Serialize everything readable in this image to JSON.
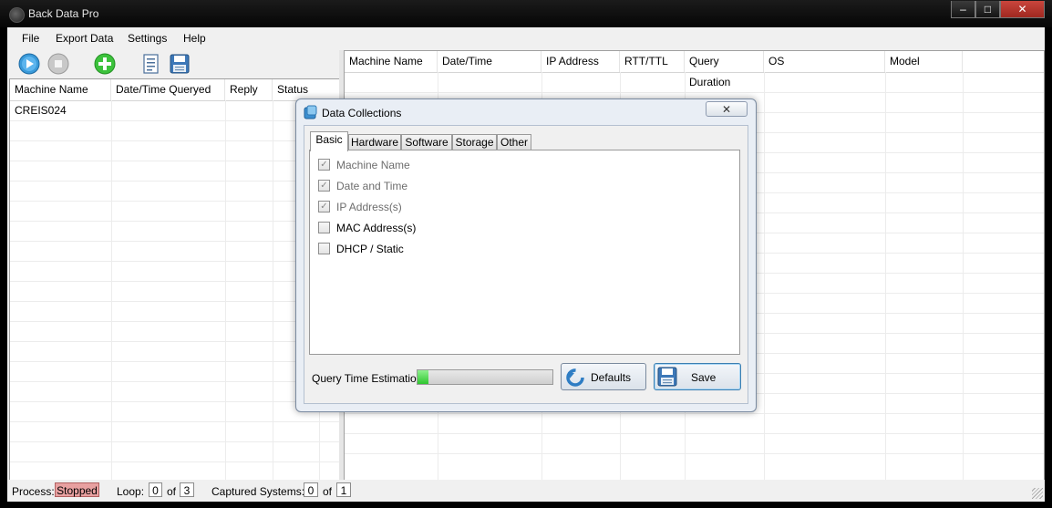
{
  "window": {
    "title": "Back Data Pro",
    "controls": [
      "‒",
      "□",
      "✕"
    ]
  },
  "menu": [
    "File",
    "Export Data",
    "Settings",
    "Help"
  ],
  "toolbar": {
    "icons": [
      "play-icon",
      "stop-icon",
      "add-icon",
      "report-icon",
      "save-icon"
    ]
  },
  "left_grid": {
    "columns": [
      "Machine Name",
      "Date/Time Queryed",
      "Reply",
      "Status"
    ],
    "rows": [
      [
        "CREIS024",
        "",
        "",
        ""
      ]
    ]
  },
  "right_grid": {
    "columns": [
      "Machine Name",
      "Date/Time",
      "IP Address",
      "RTT/TTL",
      "Query Duration",
      "OS",
      "Model"
    ]
  },
  "status": {
    "process_label": "Process:",
    "process_value": "Stopped",
    "loop_label": "Loop:",
    "loop_value": "0",
    "of": "of",
    "loop_total": "3",
    "captured_label": "Captured Systems:",
    "captured_value": "0",
    "captured_total": "1"
  },
  "dialog": {
    "title": "Data Collections",
    "close": "✕",
    "tabs": [
      "Basic",
      "Hardware",
      "Software",
      "Storage",
      "Other"
    ],
    "active_tab": "Basic",
    "options": [
      {
        "label": "Machine Name",
        "checked": true,
        "enabled": false
      },
      {
        "label": "Date and Time",
        "checked": true,
        "enabled": false
      },
      {
        "label": "IP Address(s)",
        "checked": true,
        "enabled": false
      },
      {
        "label": "MAC Address(s)",
        "checked": false,
        "enabled": true
      },
      {
        "label": "DHCP / Static",
        "checked": false,
        "enabled": true
      }
    ],
    "estimation_label": "Query Time Estimation:",
    "estimation_progress": 0.08,
    "defaults_label": "Defaults",
    "save_label": "Save"
  },
  "colors": {
    "stopped_bg": "#e8a0a0",
    "progress_fill": "#2fc62f",
    "accent": "#3c7fb1"
  }
}
